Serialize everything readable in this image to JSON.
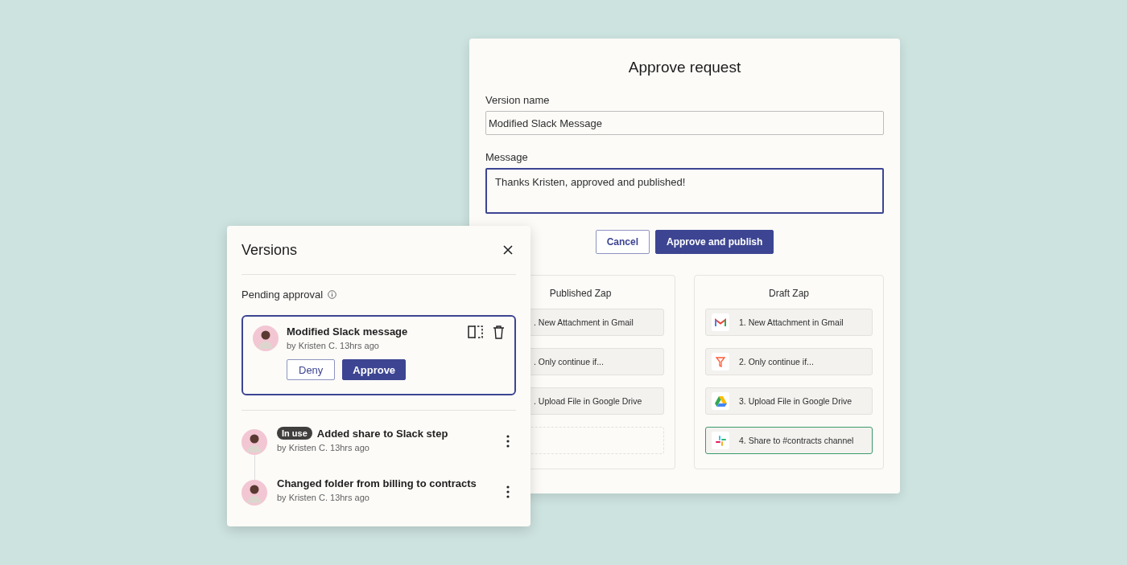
{
  "approve_dialog": {
    "title": "Approve request",
    "fields": [
      {
        "kind": "input",
        "label": "Version name",
        "value": "Modified Slack Message",
        "focused": false
      },
      {
        "kind": "textarea",
        "label": "Message",
        "value": "Thanks Kristen, approved and published!",
        "focused": true
      }
    ],
    "buttons": [
      {
        "label": "Cancel",
        "primary": false
      },
      {
        "label": "Approve and publish",
        "primary": true
      }
    ],
    "zaps": [
      {
        "title": "Published Zap",
        "steps": [
          {
            "kind": "step",
            "label": ". New Attachment in Gmail",
            "highlighted": false
          },
          {
            "kind": "step",
            "label": ". Only continue if...",
            "highlighted": false
          },
          {
            "kind": "step",
            "label": ". Upload File in Google Drive",
            "highlighted": false
          },
          {
            "kind": "empty"
          }
        ]
      },
      {
        "title": "Draft Zap",
        "steps": [
          {
            "kind": "app_step",
            "label": "1. New Attachment in Gmail",
            "highlighted": false
          },
          {
            "kind": "app_step",
            "label": "2. Only continue if...",
            "highlighted": false
          },
          {
            "kind": "app_step",
            "label": "3. Upload File in Google Drive",
            "highlighted": false
          },
          {
            "kind": "app_step",
            "label": "4. Share to #contracts channel",
            "highlighted": true
          }
        ]
      }
    ]
  },
  "versions_panel": {
    "title": "Versions",
    "section": "Pending approval",
    "pending": {
      "title": "Modified Slack message",
      "meta": "by Kristen C. 13hrs ago",
      "buttons": [
        {
          "label": "Deny",
          "primary": false
        },
        {
          "label": "Approve",
          "primary": true
        }
      ]
    },
    "history": [
      {
        "badge": "In use",
        "title": "Added share to Slack step",
        "meta": "by Kristen C. 13hrs ago"
      },
      {
        "title": "Changed folder from billing to contracts",
        "meta": "by Kristen C. 13hrs ago"
      }
    ]
  }
}
